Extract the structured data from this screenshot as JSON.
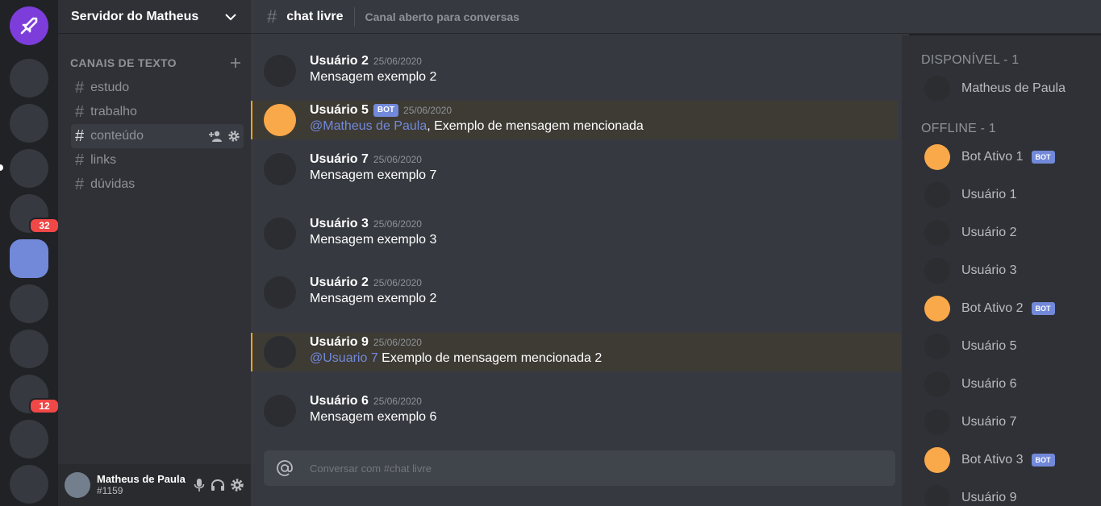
{
  "server": {
    "name": "Servidor do Matheus",
    "badges": [
      "32",
      "12"
    ]
  },
  "sidebar": {
    "category": "CANAIS DE TEXTO",
    "channels": [
      {
        "name": "estudo"
      },
      {
        "name": "trabalho"
      },
      {
        "name": "conteúdo"
      },
      {
        "name": "links"
      },
      {
        "name": "dúvidas"
      }
    ]
  },
  "user_panel": {
    "name": "Matheus de Paula",
    "tag": "#1159"
  },
  "header": {
    "channel": "chat livre",
    "topic": "Canal aberto para conversas"
  },
  "bot_label": "BOT",
  "messages": [
    {
      "author": "Usuário 2",
      "time": "25/06/2020",
      "text": "Mensagem exemplo 2"
    },
    {
      "author": "Usuário 5",
      "time": "25/06/2020",
      "mention": "@Matheus de Paula",
      "text": ", Exemplo de mensagem mencionada"
    },
    {
      "author": "Usuário 7",
      "time": "25/06/2020",
      "text": "Mensagem exemplo 7"
    },
    {
      "author": "Usuário 3",
      "time": "25/06/2020",
      "text": "Mensagem exemplo 3"
    },
    {
      "author": "Usuário 2",
      "time": "25/06/2020",
      "text": "Mensagem exemplo 2"
    },
    {
      "author": "Usuário 9",
      "time": "25/06/2020",
      "mention": "@Usuario 7",
      "text": " Exemplo de mensagem mencionada 2"
    },
    {
      "author": "Usuário 6",
      "time": "25/06/2020",
      "text": "Mensagem exemplo 6"
    }
  ],
  "composer": {
    "placeholder": "Conversar com #chat livre"
  },
  "members": {
    "online_header": "DISPONÍVEL - 1",
    "offline_header": "OFFLINE - 1",
    "online": [
      {
        "name": "Matheus de Paula"
      }
    ],
    "offline": [
      {
        "name": "Bot Ativo 1"
      },
      {
        "name": "Usuário 1"
      },
      {
        "name": "Usuário 2"
      },
      {
        "name": "Usuário 3"
      },
      {
        "name": "Bot Ativo 2"
      },
      {
        "name": "Usuário 5"
      },
      {
        "name": "Usuário 6"
      },
      {
        "name": "Usuário 7"
      },
      {
        "name": "Bot Ativo 3"
      },
      {
        "name": "Usuário 9"
      }
    ]
  },
  "colors": {
    "accent": "#7289da",
    "mention_bar": "#faa61a",
    "bot_avatar": "#faa94a",
    "badge": "#f04747"
  }
}
